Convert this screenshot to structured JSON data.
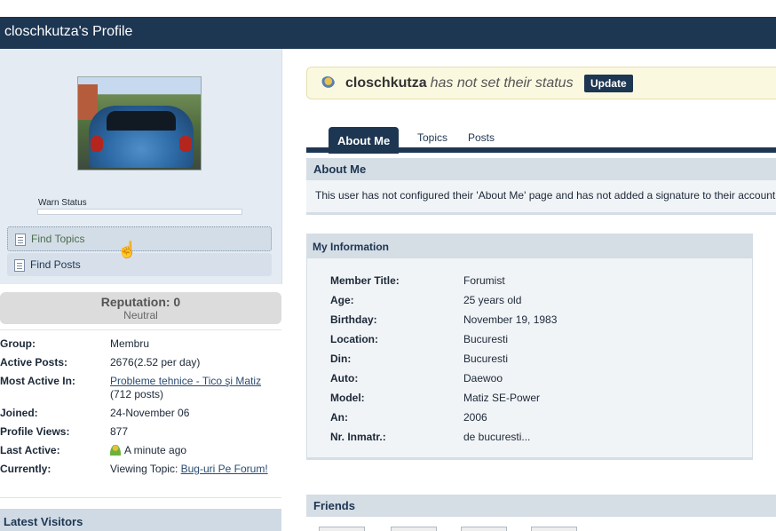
{
  "header": {
    "title": "closchkutza's Profile"
  },
  "sidebar": {
    "photo_alt": "profile-photo",
    "warn_label": "Warn Status",
    "find_topics": "Find Topics",
    "find_posts": "Find Posts"
  },
  "reputation": {
    "value": "Reputation: 0",
    "label": "Neutral"
  },
  "info": [
    {
      "key": "Group:",
      "value": "Membru"
    },
    {
      "key": "Active Posts:",
      "value": "2676(2.52 per day)"
    },
    {
      "key": "Most Active In:",
      "link": "Probleme tehnice - Tico şi Matiz",
      "suffix": "(712 posts)"
    },
    {
      "key": "Joined:",
      "value": "24-November 06"
    },
    {
      "key": "Profile Views:",
      "value": "877"
    },
    {
      "key": "Last Active:",
      "value": "A minute ago"
    },
    {
      "key": "Currently:",
      "prefix": "Viewing Topic:",
      "link": "Bug-uri Pe Forum!"
    }
  ],
  "latest_visitors": "Latest Visitors",
  "status": {
    "username": "closchkutza",
    "message": "has not set their status",
    "button": "Update"
  },
  "tabs": [
    {
      "label": "About Me"
    },
    {
      "label": "Topics"
    },
    {
      "label": "Posts"
    }
  ],
  "about": {
    "heading": "About Me",
    "body": "This user has not configured their 'About Me' page and has not added a signature to their account."
  },
  "my_information": {
    "heading": "My Information",
    "rows": [
      {
        "key": "Member Title:",
        "value": "Forumist"
      },
      {
        "key": "Age:",
        "value": "25 years old"
      },
      {
        "key": "Birthday:",
        "value": "November 19, 1983"
      },
      {
        "key": "Location:",
        "value": "Bucuresti"
      },
      {
        "key": "Din:",
        "value": "Bucuresti"
      },
      {
        "key": "Auto:",
        "value": "Daewoo"
      },
      {
        "key": "Model:",
        "value": "Matiz SE-Power"
      },
      {
        "key": "An:",
        "value": "2006"
      },
      {
        "key": "Nr. Inmatr.:",
        "value": "de bucuresti..."
      }
    ]
  },
  "friends": {
    "heading": "Friends"
  },
  "colors": {
    "header_bg": "#1d3652",
    "panel_bg": "#e4ebf2",
    "status_bg": "#fbf8e0"
  }
}
